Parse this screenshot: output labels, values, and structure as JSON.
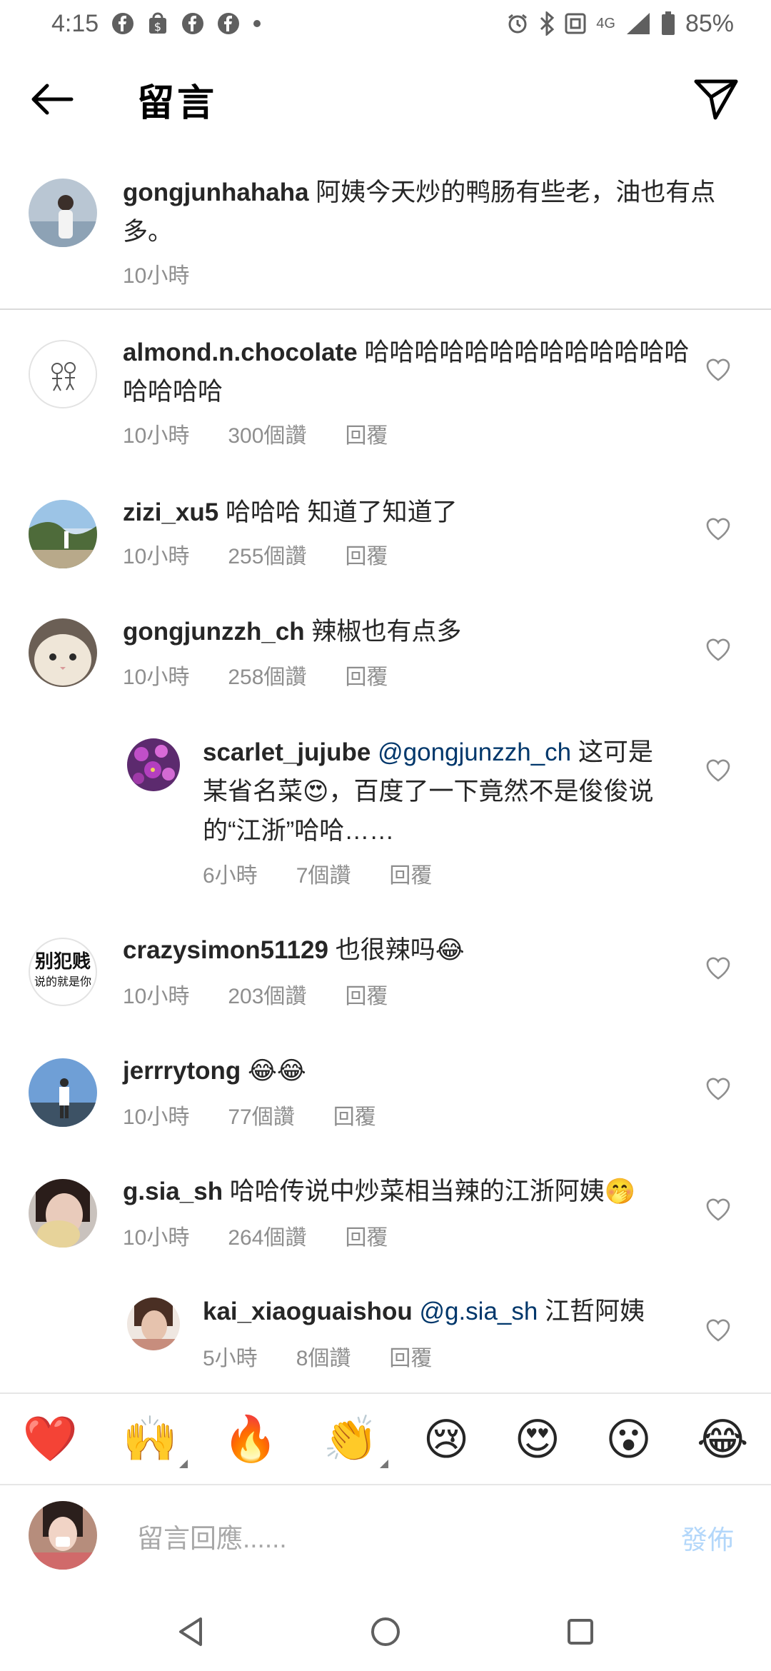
{
  "status_bar": {
    "time": "4:15",
    "network": "4G",
    "battery": "85%"
  },
  "header": {
    "title": "留言"
  },
  "caption": {
    "username": "gongjunhahaha",
    "text": " 阿姨今天炒的鸭肠有些老，油也有点多。",
    "time": "10小時"
  },
  "comments": [
    {
      "username": "almond.n.chocolate",
      "text": " 哈哈哈哈哈哈哈哈哈哈哈哈哈哈哈哈哈",
      "time": "10小時",
      "likes": "300個讚",
      "reply": "回覆"
    },
    {
      "username": "zizi_xu5",
      "text": " 哈哈哈 知道了知道了",
      "time": "10小時",
      "likes": "255個讚",
      "reply": "回覆"
    },
    {
      "username": "gongjunzzh_ch",
      "text": " 辣椒也有点多",
      "time": "10小時",
      "likes": "258個讚",
      "reply": "回覆"
    },
    {
      "username": "scarlet_jujube",
      "mention": "@gongjunzzh_ch",
      "text": " 这可是某省名菜😍，百度了一下竟然不是俊俊说的“江浙”哈哈……",
      "time": "6小時",
      "likes": "7個讚",
      "reply": "回覆"
    },
    {
      "username": "crazysimon51129",
      "text": " 也很辣吗😂",
      "time": "10小時",
      "likes": "203個讚",
      "reply": "回覆",
      "avatar_text_1": "别犯贱",
      "avatar_text_2": "说的就是你"
    },
    {
      "username": "jerrrytong",
      "text": " 😂😂",
      "time": "10小時",
      "likes": "77個讚",
      "reply": "回覆"
    },
    {
      "username": "g.sia_sh",
      "text": " 哈哈传说中炒菜相当辣的江浙阿姨🤭",
      "time": "10小時",
      "likes": "264個讚",
      "reply": "回覆"
    },
    {
      "username": "kai_xiaoguaishou",
      "mention": "@g.sia_sh",
      "text": " 江哲阿姨",
      "time": "5小時",
      "likes": "8個讚",
      "reply": "回覆"
    }
  ],
  "emoji_bar": [
    "❤️",
    "🙌",
    "🔥",
    "👏",
    "😢",
    "😍",
    "😮",
    "😂"
  ],
  "input": {
    "placeholder": "留言回應......",
    "post_label": "發佈"
  },
  "icons": [
    "back-arrow-icon",
    "send-icon",
    "heart-icon",
    "nav-back-icon",
    "nav-home-icon",
    "nav-recents-icon"
  ],
  "colors": {
    "mention": "#00376b",
    "meta": "#8e8e8e",
    "post_disabled": "#b3d7fa"
  }
}
